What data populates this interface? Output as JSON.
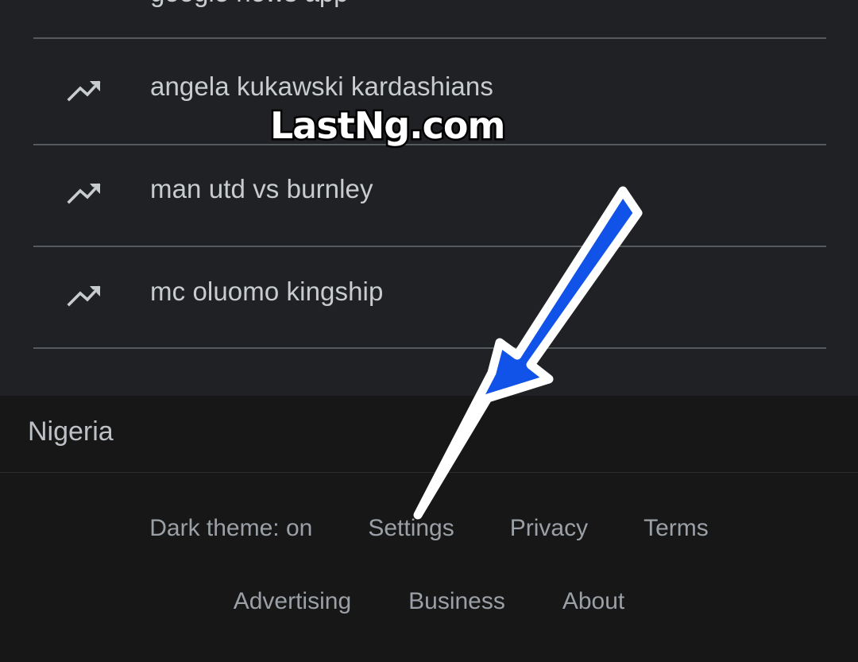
{
  "trending": {
    "clipped_top_row": "google news app",
    "icon_name": "trending-up-icon",
    "items": [
      {
        "label": "angela kukawski kardashians"
      },
      {
        "label": "man utd vs burnley"
      },
      {
        "label": "mc oluomo kingship"
      }
    ]
  },
  "watermark": {
    "text": "LastNg.com"
  },
  "region": {
    "label": "Nigeria"
  },
  "footer": {
    "row1": [
      {
        "label": "Dark theme: on"
      },
      {
        "label": "Settings"
      },
      {
        "label": "Privacy"
      },
      {
        "label": "Terms"
      }
    ],
    "row2": [
      {
        "label": "Advertising"
      },
      {
        "label": "Business"
      },
      {
        "label": "About"
      }
    ]
  },
  "annotation": {
    "arrow_name": "blue-pointer-arrow",
    "points_to": "Settings",
    "fill_color": "#1153e8",
    "outline_color": "#ffffff"
  },
  "colors": {
    "page_bg": "#202124",
    "footer_bg": "#171717",
    "text": "#c9ccce",
    "muted_text": "#9aa0a6",
    "divider": "#555a5e"
  }
}
